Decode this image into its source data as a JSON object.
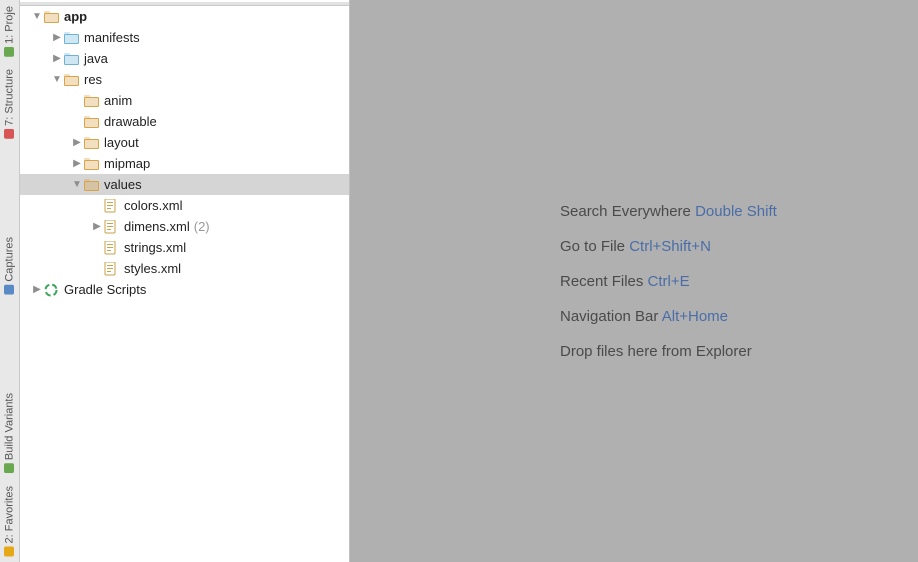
{
  "toolstrip": {
    "top": [
      {
        "label": "1: Proje",
        "icon": "project"
      },
      {
        "label": "7: Structure",
        "icon": "structure"
      }
    ],
    "middle": [
      {
        "label": "Captures",
        "icon": "captures"
      }
    ],
    "bottom": [
      {
        "label": "Build Variants",
        "icon": "build"
      },
      {
        "label": "2: Favorites",
        "icon": "favorites"
      }
    ]
  },
  "tree": [
    {
      "depth": 0,
      "arrow": "down",
      "icon": "module",
      "label": "app",
      "bold": true
    },
    {
      "depth": 1,
      "arrow": "right",
      "icon": "folder",
      "label": "manifests"
    },
    {
      "depth": 1,
      "arrow": "right",
      "icon": "folder",
      "label": "java"
    },
    {
      "depth": 1,
      "arrow": "down",
      "icon": "res",
      "label": "res"
    },
    {
      "depth": 2,
      "arrow": "none",
      "icon": "res",
      "label": "anim"
    },
    {
      "depth": 2,
      "arrow": "none",
      "icon": "res",
      "label": "drawable"
    },
    {
      "depth": 2,
      "arrow": "right",
      "icon": "res",
      "label": "layout"
    },
    {
      "depth": 2,
      "arrow": "right",
      "icon": "res",
      "label": "mipmap"
    },
    {
      "depth": 2,
      "arrow": "down",
      "icon": "res",
      "label": "values",
      "selected": true
    },
    {
      "depth": 3,
      "arrow": "none",
      "icon": "xml",
      "label": "colors.xml"
    },
    {
      "depth": 3,
      "arrow": "right",
      "icon": "xml",
      "label": "dimens.xml",
      "suffix": "(2)"
    },
    {
      "depth": 3,
      "arrow": "none",
      "icon": "xml",
      "label": "strings.xml"
    },
    {
      "depth": 3,
      "arrow": "none",
      "icon": "xml",
      "label": "styles.xml"
    },
    {
      "depth": 0,
      "arrow": "right",
      "icon": "gradle",
      "label": "Gradle Scripts"
    }
  ],
  "hints": [
    {
      "text": "Search Everywhere",
      "shortcut": "Double Shift"
    },
    {
      "text": "Go to File",
      "shortcut": "Ctrl+Shift+N"
    },
    {
      "text": "Recent Files",
      "shortcut": "Ctrl+E"
    },
    {
      "text": "Navigation Bar",
      "shortcut": "Alt+Home"
    },
    {
      "text": "Drop files here from Explorer",
      "shortcut": ""
    }
  ],
  "icon_colors": {
    "module": "#d9a34a",
    "folder": "#6fb3d2",
    "res": "#d9a34a",
    "xml": "#d9a34a",
    "gradle": "#3ba55c"
  }
}
